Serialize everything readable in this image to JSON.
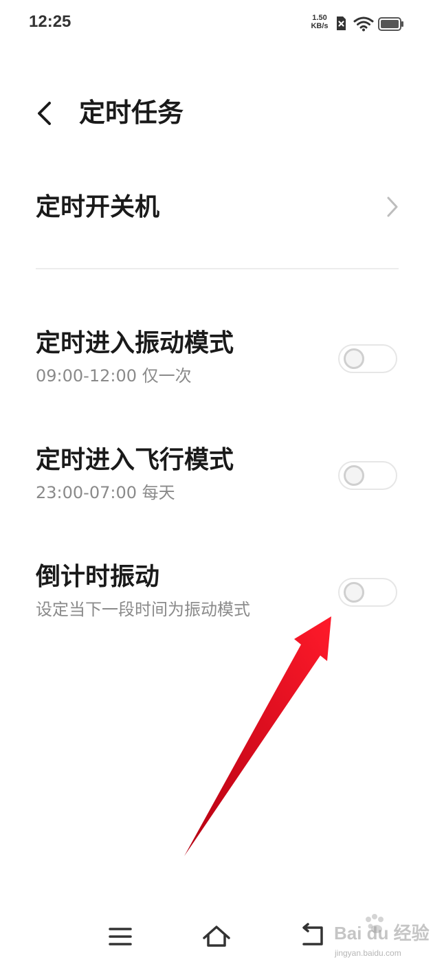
{
  "status_bar": {
    "time": "12:25",
    "net_speed_value": "1.50",
    "net_speed_unit": "KB/s",
    "icons": [
      "sim-blocked-icon",
      "wifi-icon",
      "battery-icon"
    ]
  },
  "header": {
    "title": "定时任务",
    "back_icon": "chevron-left-icon"
  },
  "items": [
    {
      "title": "定时开关机",
      "type": "link"
    },
    {
      "title": "定时进入振动模式",
      "subtitle": "09:00-12:00 仅一次",
      "type": "toggle",
      "enabled": false
    },
    {
      "title": "定时进入飞行模式",
      "subtitle": "23:00-07:00 每天",
      "type": "toggle",
      "enabled": false
    },
    {
      "title": "倒计时振动",
      "subtitle": "设定当下一段时间为振动模式",
      "type": "toggle",
      "enabled": false
    }
  ],
  "nav_bar": {
    "icons": [
      "menu-icon",
      "home-icon",
      "back-icon"
    ]
  },
  "watermark": {
    "text": "Bai du 经验",
    "url": "jingyan.baidu.com"
  },
  "colors": {
    "background": "#ffffff",
    "title_text": "#1a1a1a",
    "subtitle_text": "#8a8a8a",
    "annotation_arrow": "#e3001b"
  }
}
